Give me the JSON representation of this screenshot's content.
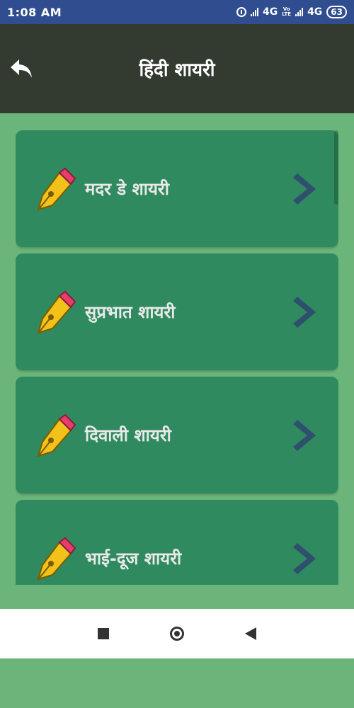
{
  "status": {
    "time": "1:08 AM",
    "network_1": "4G",
    "volte_top": "Vo",
    "volte_bottom": "LTE",
    "network_2": "4G",
    "battery": "63"
  },
  "header": {
    "title": "हिंदी शायरी"
  },
  "list": {
    "items": [
      {
        "label": "मदर डे शायरी"
      },
      {
        "label": "सुप्रभात शायरी"
      },
      {
        "label": "दिवाली शायरी"
      },
      {
        "label": "भाई-दूज शायरी"
      }
    ]
  },
  "colors": {
    "status_bar": "#2f4d8f",
    "app_bar": "#333a2f",
    "background": "#6cb57a",
    "card": "#2f8a5f",
    "chevron": "#2f4f6d",
    "pen_nib": "#f2c21b",
    "pen_cap": "#e83d6a"
  }
}
